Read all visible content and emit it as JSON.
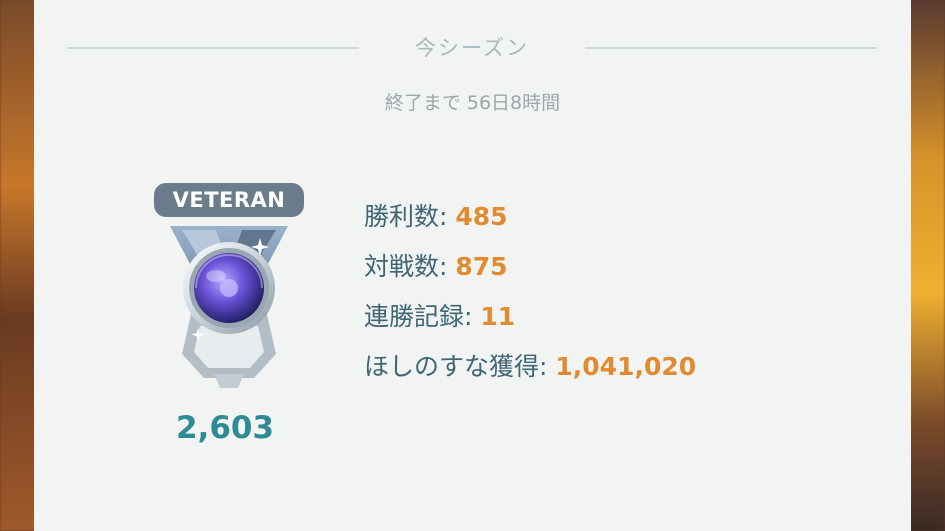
{
  "season": {
    "title": "今シーズン",
    "remaining": "終了まで 56日8時間"
  },
  "rank": {
    "label": "VETERAN",
    "rating": "2,603"
  },
  "stats": [
    {
      "label": "勝利数: ",
      "value": "485"
    },
    {
      "label": "対戦数: ",
      "value": "875"
    },
    {
      "label": "連勝記録: ",
      "value": "11"
    },
    {
      "label": "ほしのすな獲得: ",
      "value": "1,041,020"
    }
  ],
  "colors": {
    "panel_background": "#f1f4f3",
    "label_text": "#3f6675",
    "value_text": "#e28a30",
    "rating_text": "#2e8a94",
    "rank_label_bg": "#6b7d8d"
  }
}
